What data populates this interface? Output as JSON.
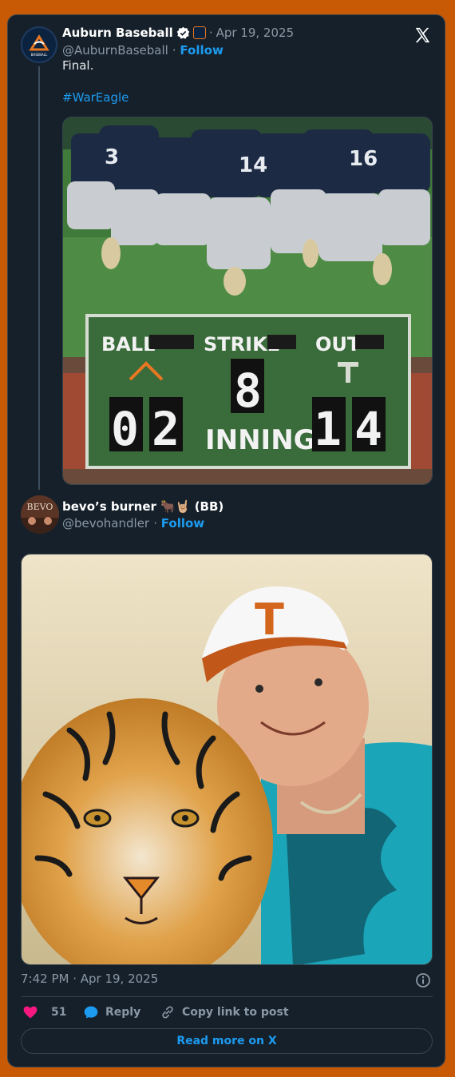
{
  "tweet1": {
    "display_name": "Auburn Baseball",
    "date": "Apr 19, 2025",
    "handle": "@AuburnBaseball",
    "follow_label": "Follow",
    "text": "Final.",
    "hashtag": "#WarEagle",
    "avatar_text": "BASEBALL",
    "image": {
      "jerseys": [
        "3",
        "14",
        "16"
      ],
      "scoreboard": {
        "labels": [
          "BALL",
          "STRIKE",
          "OUT",
          "INNING"
        ],
        "home_digits": "02",
        "inning_digit": "8",
        "away_digits": "14"
      }
    }
  },
  "tweet2": {
    "display_name": "bevo’s burner 🐂🤘🏼 (BB)",
    "handle": "@bevohandler",
    "follow_label": "Follow",
    "avatar_text": "BEVO",
    "image": {
      "cap_letter": "T"
    }
  },
  "timestamp": "7:42 PM · Apr 19, 2025",
  "actions": {
    "likes": "51",
    "reply": "Reply",
    "copy": "Copy link to post"
  },
  "read_more": "Read more on X",
  "colors": {
    "accent": "#1d9bf0",
    "heart": "#f91880",
    "background": "#15202b",
    "frame": "#c85a06"
  }
}
